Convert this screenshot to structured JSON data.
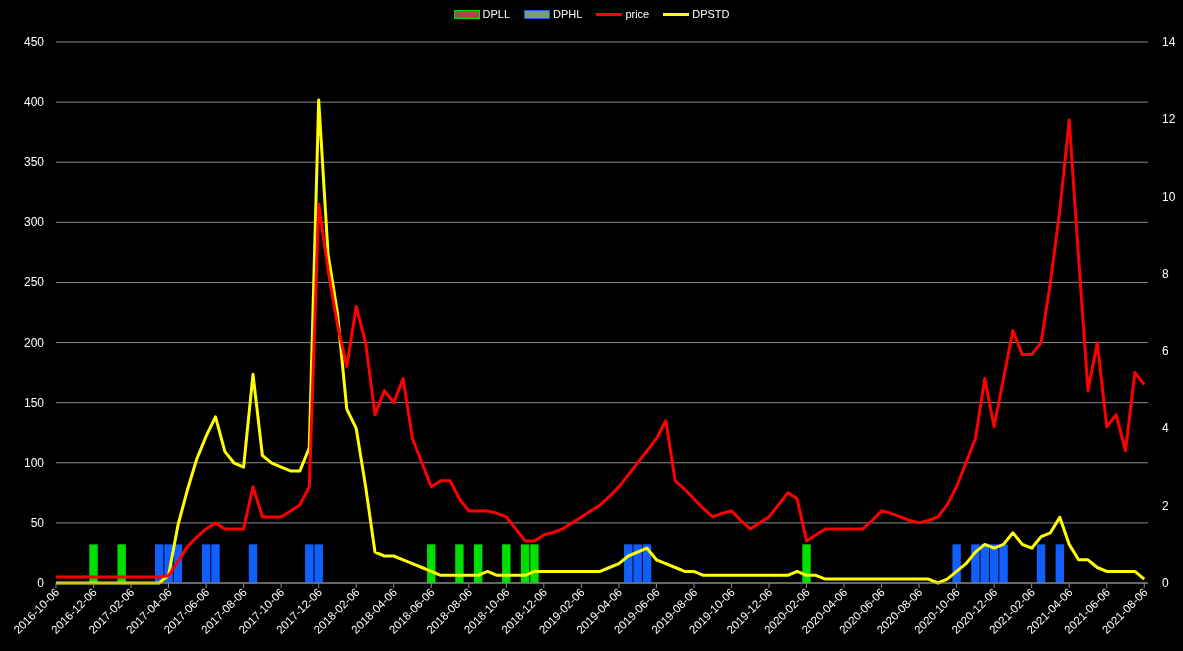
{
  "chart": {
    "chart_data": {
      "type": "line",
      "categories": [
        "2016-10-06",
        null,
        null,
        null,
        "2016-12-06",
        null,
        null,
        null,
        "2017-02-06",
        null,
        null,
        null,
        "2017-04-06",
        null,
        null,
        null,
        "2017-06-06",
        null,
        null,
        null,
        "2017-08-06",
        null,
        null,
        null,
        "2017-10-06",
        null,
        null,
        null,
        "2017-12-06",
        null,
        null,
        null,
        "2018-02-06",
        null,
        null,
        null,
        "2018-04-06",
        null,
        null,
        null,
        "2018-06-06",
        null,
        null,
        null,
        "2018-08-06",
        null,
        null,
        null,
        "2018-10-06",
        null,
        null,
        null,
        "2018-12-06",
        null,
        null,
        null,
        "2019-02-06",
        null,
        null,
        null,
        "2019-04-06",
        null,
        null,
        null,
        "2019-06-06",
        null,
        null,
        null,
        "2019-08-06",
        null,
        null,
        null,
        "2019-10-06",
        null,
        null,
        null,
        "2019-12-06",
        null,
        null,
        null,
        "2020-02-06",
        null,
        null,
        null,
        "2020-04-06",
        null,
        null,
        null,
        "2020-06-06",
        null,
        null,
        null,
        "2020-08-06",
        null,
        null,
        null,
        "2020-10-06",
        null,
        null,
        null,
        "2020-12-06",
        null,
        null,
        null,
        "2021-02-06",
        null,
        null,
        null,
        "2021-04-06",
        null,
        null,
        null,
        "2021-06-06",
        null,
        null,
        null,
        "2021-08-06"
      ],
      "grid": true,
      "ylim": [
        0,
        450
      ],
      "y2lim": [
        0,
        14
      ],
      "yticks": [
        0,
        50,
        100,
        150,
        200,
        250,
        300,
        350,
        400,
        450
      ],
      "y2ticks": [
        0,
        2,
        4,
        6,
        8,
        10,
        12,
        14
      ],
      "series": [
        {
          "name": "DPLL",
          "type": "bar",
          "axis": "y2",
          "color": "#00e000",
          "values": [
            null,
            null,
            null,
            null,
            1,
            null,
            null,
            1,
            null,
            null,
            null,
            null,
            null,
            null,
            null,
            null,
            null,
            null,
            null,
            null,
            null,
            null,
            null,
            null,
            null,
            null,
            null,
            null,
            null,
            null,
            null,
            null,
            null,
            null,
            null,
            null,
            null,
            null,
            null,
            null,
            1,
            null,
            null,
            1,
            null,
            1,
            null,
            null,
            1,
            null,
            1,
            1,
            null,
            null,
            null,
            null,
            null,
            null,
            null,
            null,
            null,
            null,
            null,
            null,
            null,
            null,
            null,
            null,
            null,
            null,
            null,
            null,
            null,
            null,
            null,
            null,
            null,
            null,
            null,
            null,
            1,
            null,
            null,
            null,
            null,
            null,
            null,
            null,
            null,
            null,
            null,
            null,
            null,
            null,
            null,
            null,
            null,
            null,
            null,
            null,
            null,
            null,
            null,
            null,
            null,
            null,
            null,
            null,
            null,
            null,
            null,
            null,
            null,
            null,
            null,
            null,
            null
          ]
        },
        {
          "name": "DPHL",
          "type": "bar",
          "axis": "y2",
          "color": "#1060ff",
          "values": [
            null,
            null,
            null,
            null,
            null,
            null,
            null,
            null,
            null,
            null,
            null,
            1,
            1,
            1,
            null,
            null,
            1,
            1,
            null,
            null,
            null,
            1,
            null,
            null,
            null,
            null,
            null,
            1,
            1,
            null,
            null,
            null,
            null,
            null,
            null,
            null,
            null,
            null,
            null,
            null,
            null,
            null,
            null,
            null,
            null,
            null,
            null,
            null,
            null,
            null,
            null,
            null,
            null,
            null,
            null,
            null,
            null,
            null,
            null,
            null,
            null,
            1,
            1,
            1,
            null,
            null,
            null,
            null,
            null,
            null,
            null,
            null,
            null,
            null,
            null,
            null,
            null,
            null,
            null,
            null,
            null,
            null,
            null,
            null,
            null,
            null,
            null,
            null,
            null,
            null,
            null,
            null,
            null,
            null,
            null,
            null,
            1,
            null,
            1,
            1,
            1,
            1,
            null,
            null,
            null,
            1,
            null,
            1,
            null,
            null,
            null,
            null,
            null,
            null,
            null,
            null,
            null
          ]
        },
        {
          "name": "price",
          "type": "line",
          "color": "#ff0000",
          "values": [
            5,
            5,
            5,
            5,
            5,
            5,
            5,
            5,
            5,
            5,
            5,
            5,
            6,
            18,
            30,
            38,
            45,
            50,
            45,
            45,
            45,
            80,
            55,
            55,
            55,
            60,
            65,
            80,
            315,
            260,
            215,
            180,
            230,
            200,
            140,
            160,
            150,
            170,
            120,
            100,
            80,
            85,
            85,
            70,
            60,
            60,
            60,
            58,
            55,
            45,
            35,
            35,
            40,
            42,
            45,
            50,
            55,
            60,
            65,
            72,
            80,
            90,
            100,
            110,
            120,
            135,
            85,
            78,
            70,
            62,
            55,
            58,
            60,
            52,
            45,
            50,
            55,
            65,
            75,
            70,
            35,
            40,
            45,
            45,
            45,
            45,
            45,
            52,
            60,
            58,
            55,
            52,
            50,
            52,
            55,
            65,
            80,
            100,
            120,
            170,
            130,
            170,
            210,
            190,
            190,
            200,
            250,
            310,
            385,
            270,
            160,
            200,
            130,
            140,
            110,
            175,
            165
          ]
        },
        {
          "name": "DPSTD",
          "type": "line",
          "axis": "y2",
          "color": "#ffff00",
          "values": [
            0.0,
            0.0,
            0.0,
            0.0,
            0.0,
            0.0,
            0.0,
            0.0,
            0.0,
            0.0,
            0.0,
            0.0,
            0.2,
            1.5,
            2.4,
            3.2,
            3.8,
            4.3,
            3.4,
            3.1,
            3.0,
            5.4,
            3.3,
            3.1,
            3.0,
            2.9,
            2.9,
            3.5,
            12.5,
            8.5,
            7.0,
            4.5,
            4.0,
            2.5,
            0.8,
            0.7,
            0.7,
            0.6,
            0.5,
            0.4,
            0.3,
            0.2,
            0.2,
            0.2,
            0.2,
            0.2,
            0.3,
            0.2,
            0.2,
            0.2,
            0.2,
            0.3,
            0.3,
            0.3,
            0.3,
            0.3,
            0.3,
            0.3,
            0.3,
            0.4,
            0.5,
            0.7,
            0.8,
            0.9,
            0.6,
            0.5,
            0.4,
            0.3,
            0.3,
            0.2,
            0.2,
            0.2,
            0.2,
            0.2,
            0.2,
            0.2,
            0.2,
            0.2,
            0.2,
            0.3,
            0.2,
            0.2,
            0.1,
            0.1,
            0.1,
            0.1,
            0.1,
            0.1,
            0.1,
            0.1,
            0.1,
            0.1,
            0.1,
            0.1,
            0.0,
            0.1,
            0.3,
            0.5,
            0.8,
            1.0,
            0.9,
            1.0,
            1.3,
            1.0,
            0.9,
            1.2,
            1.3,
            1.7,
            1.0,
            0.6,
            0.6,
            0.4,
            0.3,
            0.3,
            0.3,
            0.3,
            0.1
          ]
        }
      ]
    }
  }
}
